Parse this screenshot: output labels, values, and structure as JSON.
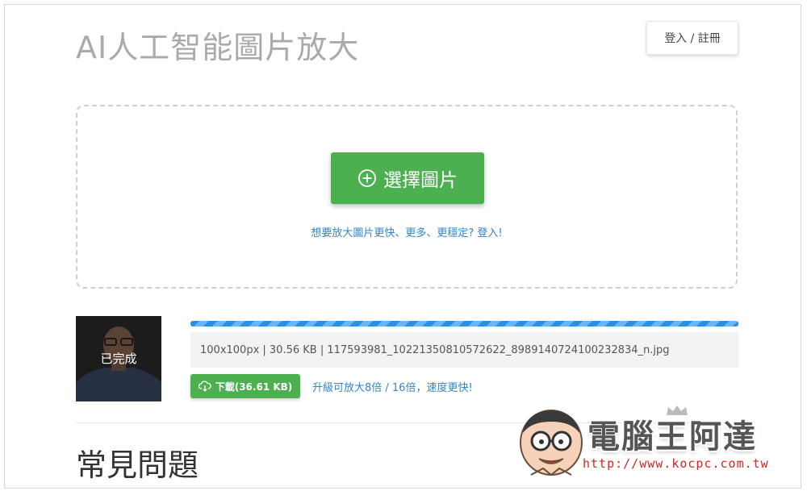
{
  "header": {
    "title": "AI人工智能圖片放大",
    "login_label": "登入 / 註冊"
  },
  "dropzone": {
    "choose_label": "選擇圖片",
    "upsell_text": "想要放大圖片更快、更多、更穩定? 登入!"
  },
  "result": {
    "status": "已完成",
    "progress": 1.0,
    "file_info": "100x100px | 30.56 KB | 117593981_10221350810572622_8989140724100232834_n.jpg",
    "download_label": "下載(36.61 KB)",
    "upgrade_text": "升級可放大8倍 / 16倍，速度更快!"
  },
  "faq": {
    "title": "常見問題"
  },
  "watermark": {
    "brand": "電腦王阿達",
    "url": "http://www.kocpc.com.tw"
  },
  "colors": {
    "primary_green": "#4caf50",
    "link_blue": "#2f86c9",
    "progress_blue": "#2e8fe0",
    "title_gray": "#aaaaaa"
  }
}
